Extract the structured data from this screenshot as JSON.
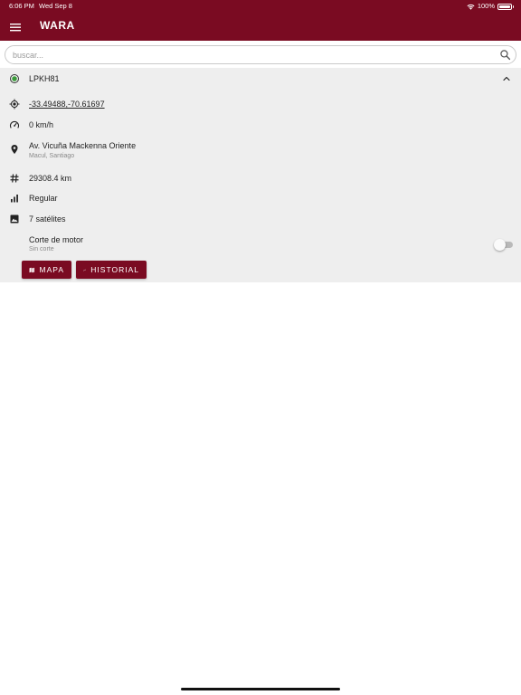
{
  "status_bar": {
    "time": "6:06 PM",
    "date": "Wed Sep 8",
    "battery": "100%",
    "icons": [
      "wifi-icon",
      "battery-icon"
    ]
  },
  "app_bar": {
    "title": "WARA",
    "menu_icon": "menu-icon"
  },
  "search": {
    "placeholder": "buscar...",
    "value": "",
    "icon": "search-icon"
  },
  "vehicle": {
    "name": "LPKH81",
    "status_color": "#3a9a3a",
    "expanded": true,
    "coordinates": "-33.49488,-70.61697",
    "speed": "0 km/h",
    "address": "Av. Vicuña Mackenna Oriente",
    "address_sub": "Macul, Santiago",
    "odometer": "29308.4 km",
    "signal": "Regular",
    "satellites": "7 satélites",
    "engine_cut": {
      "label": "Corte de motor",
      "status": "Sin corte",
      "enabled": false
    }
  },
  "actions": {
    "map_label": "MAPA",
    "history_label": "HISTORIAL"
  },
  "colors": {
    "brand": "#7a0b22",
    "panel_bg": "#eeeeee",
    "link": "#1a0dab"
  }
}
